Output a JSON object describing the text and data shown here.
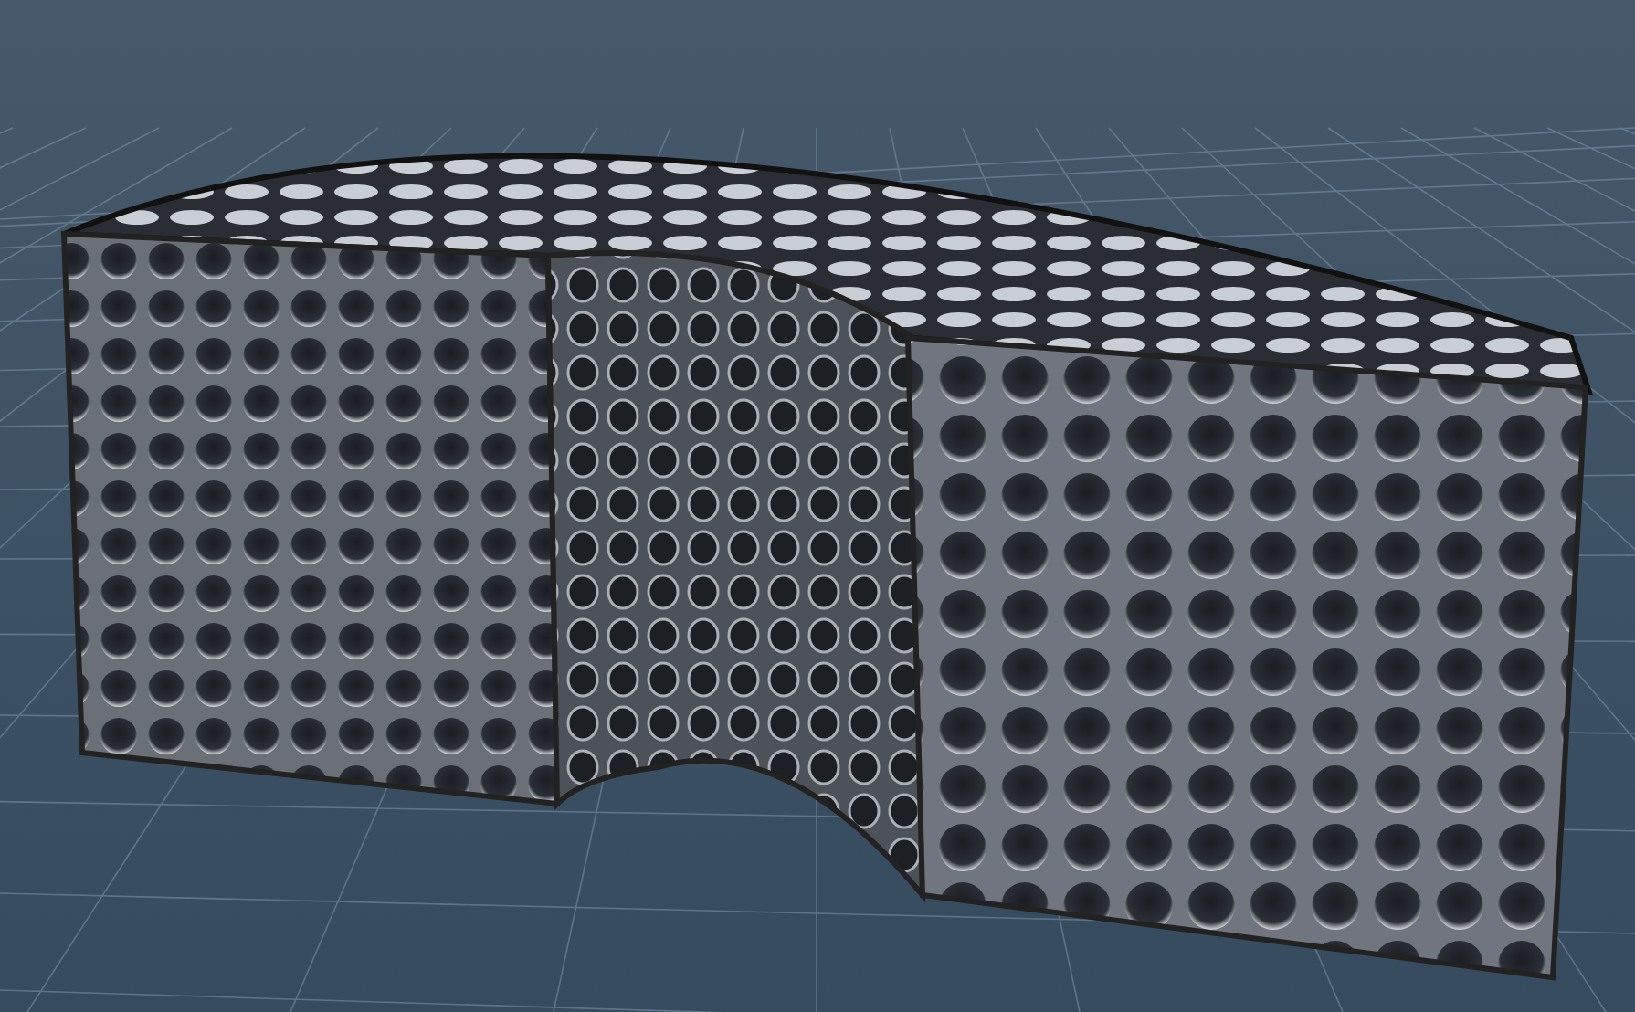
{
  "viewport": {
    "kind": "render3d",
    "grid_visible": true
  }
}
